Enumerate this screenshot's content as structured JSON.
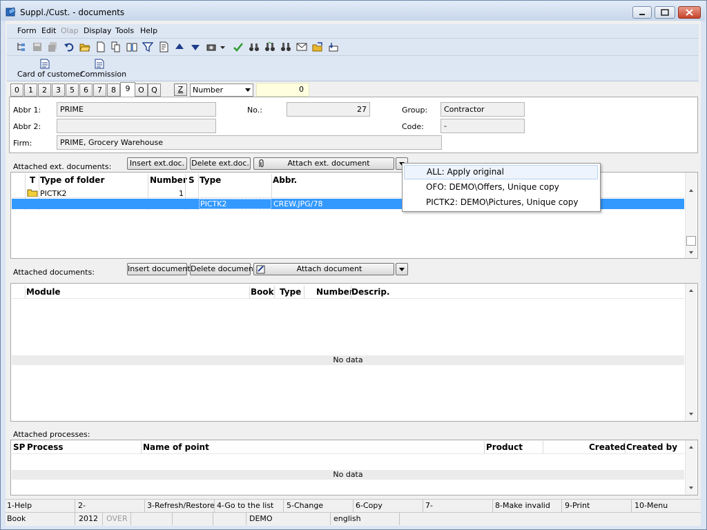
{
  "window": {
    "title": "Suppl./Cust. - documents"
  },
  "menu": [
    "Form",
    "Edit",
    "Olap",
    "Display",
    "Tools",
    "Help"
  ],
  "menu_disabled": [
    "Olap"
  ],
  "toolbar2": {
    "card_label": "Card of customer",
    "commission_label": "Commission"
  },
  "tabs": [
    "0",
    "1",
    "2",
    "3",
    "5",
    "6",
    "7",
    "8",
    "9",
    "O",
    "Q"
  ],
  "active_tab": "9",
  "filter": {
    "z_label": "Z",
    "sort_by": "Number",
    "number_value": "0"
  },
  "form": {
    "abbr1_label": "Abbr 1:",
    "abbr1_value": "PRIME",
    "abbr2_label": "Abbr 2:",
    "abbr2_value": "",
    "firm_label": "Firm:",
    "firm_value": "PRIME, Grocery Warehouse",
    "no_label": "No.:",
    "no_value": "27",
    "group_label": "Group:",
    "group_value": "Contractor",
    "code_label": "Code:",
    "code_value": "-"
  },
  "ext_docs": {
    "section_label": "Attached ext. documents:",
    "insert_label": "Insert ext.doc.",
    "delete_label": "Delete ext.doc.",
    "attach_label": "Attach ext. document",
    "columns": [
      "T",
      "Type of folder",
      "Number",
      "S",
      "Type",
      "Abbr."
    ],
    "rows": [
      {
        "folder": "PICTK2",
        "number": "1",
        "type": "",
        "abbr": ""
      },
      {
        "folder": "",
        "number": "",
        "type": "PICTK2",
        "abbr": "CREW.JPG/78"
      }
    ]
  },
  "attach_popup": {
    "items": [
      "ALL: Apply original",
      "OFO: DEMO\\Offers, Unique copy",
      "PICTK2: DEMO\\Pictures, Unique copy"
    ]
  },
  "docs": {
    "section_label": "Attached documents:",
    "insert_label": "Insert document",
    "delete_label": "Delete document",
    "attach_label": "Attach document",
    "columns": [
      "Module",
      "Book",
      "Type",
      "Number",
      "Descrip."
    ],
    "empty_text": "No data"
  },
  "processes": {
    "section_label": "Attached processes:",
    "columns": [
      "SP",
      "Process",
      "Name of point",
      "Product",
      "Created",
      "Created by"
    ],
    "empty_text": "No data"
  },
  "fkeys": [
    "1-Help",
    "2-",
    "3-Refresh/Restore",
    "4-Go to the list",
    "5-Change",
    "6-Copy",
    "7-",
    "8-Make invalid",
    "9-Print",
    "10-Menu"
  ],
  "status": {
    "book": "Book",
    "year": "2012",
    "over": "OVER",
    "db": "DEMO",
    "language": "english"
  },
  "colors": {
    "selection": "#3399ff",
    "titlebar": "#c7d6ea",
    "toolbar": "#dde6f3",
    "highlight_field": "#ffffe0"
  }
}
